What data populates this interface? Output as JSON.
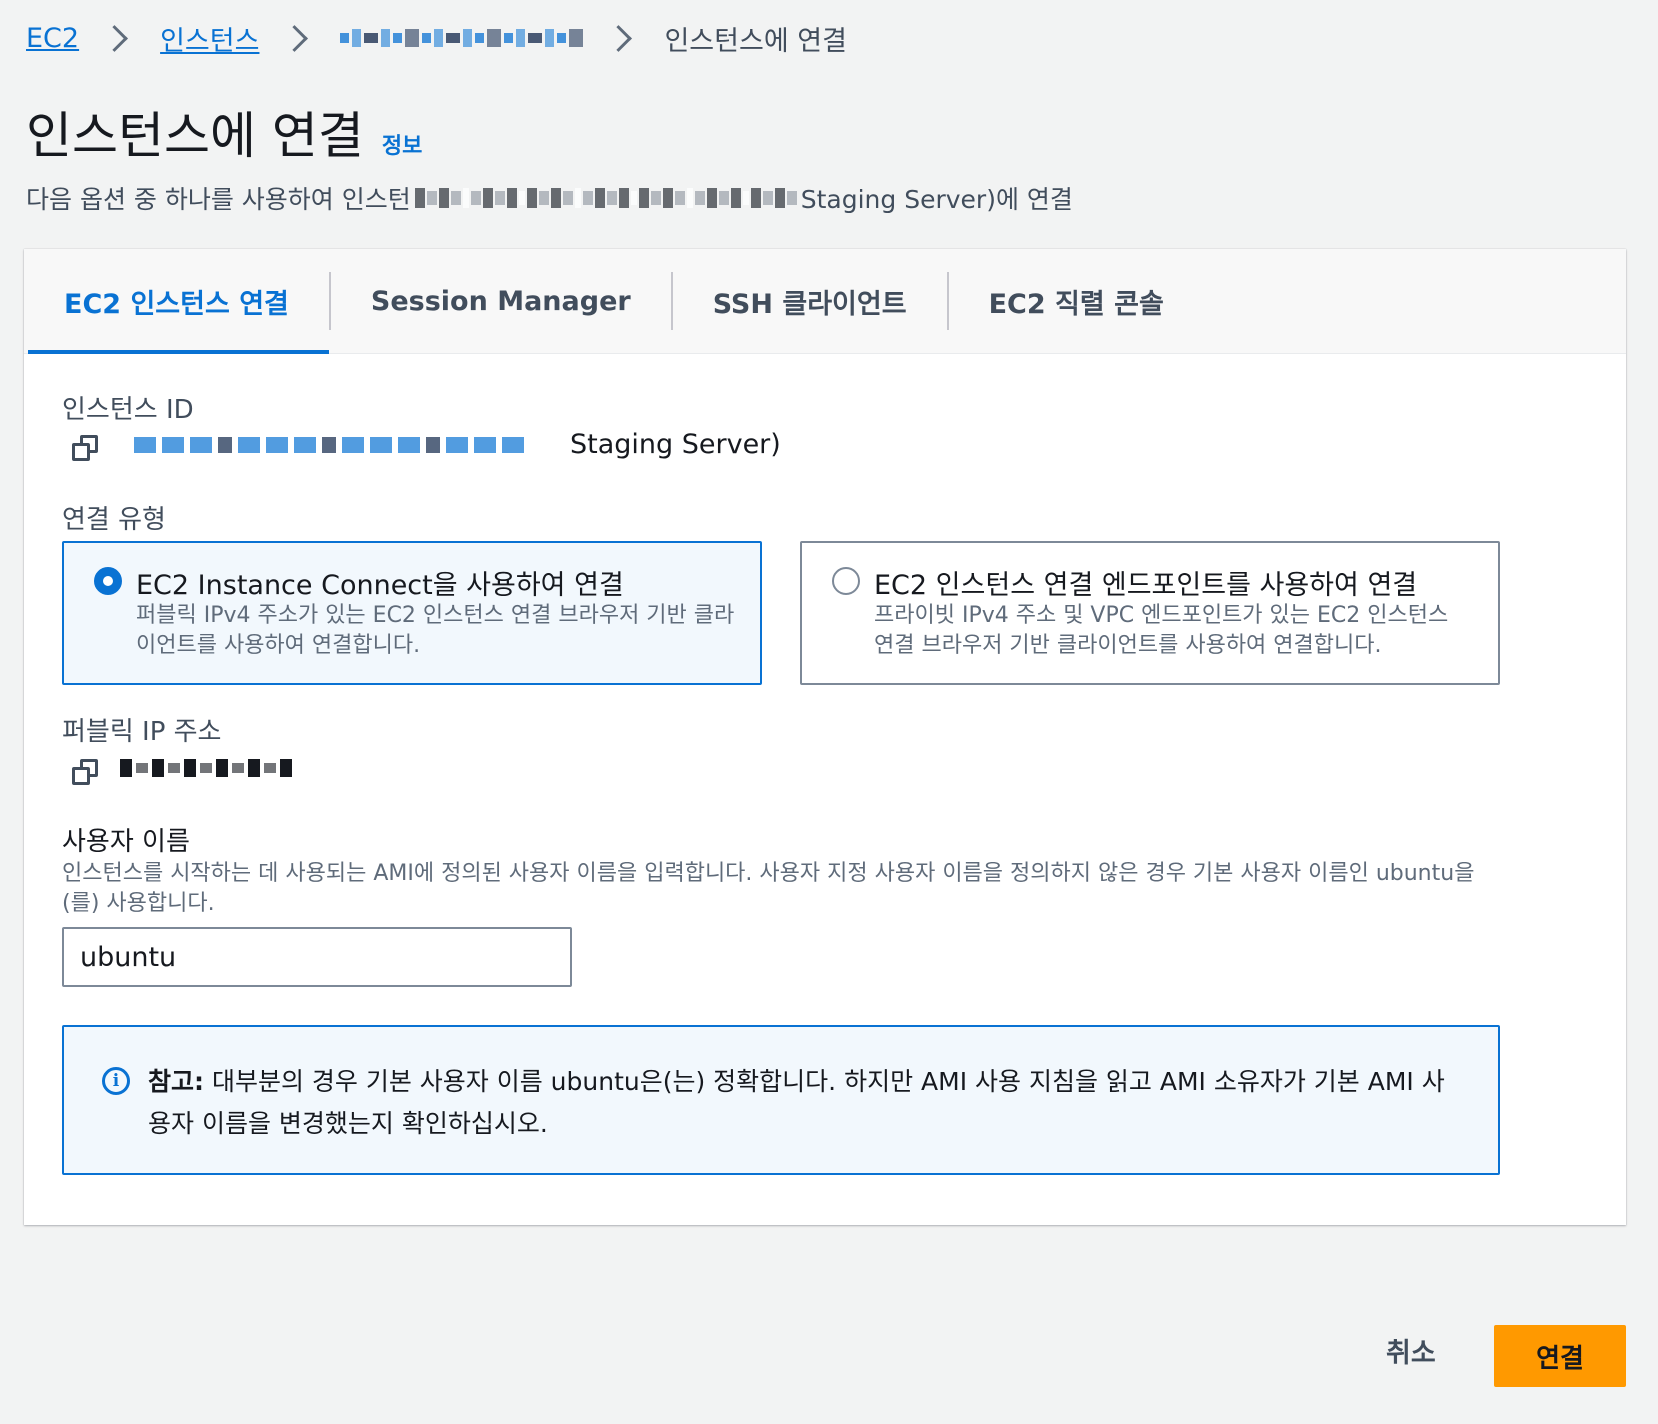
{
  "breadcrumb": {
    "items": [
      "EC2",
      "인스턴스"
    ],
    "current": "인스턴스에 연결"
  },
  "page": {
    "title": "인스턴스에 연결",
    "info_link": "정보",
    "description_prefix": "다음 옵션 중 하나를 사용하여 인스턴",
    "description_suffix": "Staging Server)에 연결"
  },
  "tabs": [
    "EC2 인스턴스 연결",
    "Session Manager",
    "SSH 클라이언트",
    "EC2 직렬 콘솔"
  ],
  "instance": {
    "id_label": "인스턴스 ID",
    "id_visible_suffix": "Staging Server)"
  },
  "connection_type": {
    "label": "연결 유형",
    "options": [
      {
        "title": "EC2 Instance Connect을 사용하여 연결",
        "description": "퍼블릭 IPv4 주소가 있는 EC2 인스턴스 연결 브라우저 기반 클라이언트를 사용하여 연결합니다.",
        "selected": true
      },
      {
        "title": "EC2 인스턴스 연결 엔드포인트를 사용하여 연결",
        "description": "프라이빗 IPv4 주소 및 VPC 엔드포인트가 있는 EC2 인스턴스 연결 브라우저 기반 클라이언트를 사용하여 연결합니다.",
        "selected": false
      }
    ]
  },
  "public_ip": {
    "label": "퍼블릭 IP 주소"
  },
  "username": {
    "label": "사용자 이름",
    "hint": "인스턴스를 시작하는 데 사용되는 AMI에 정의된 사용자 이름을 입력합니다. 사용자 지정 사용자 이름을 정의하지 않은 경우 기본 사용자 이름인 ubuntu을(를) 사용합니다.",
    "value": "ubuntu"
  },
  "note": {
    "prefix": "참고:",
    "text": " 대부분의 경우 기본 사용자 이름 ubuntu은(는) 정확합니다. 하지만 AMI 사용 지침을 읽고 AMI 소유자가 기본 AMI 사용자 이름을 변경했는지 확인하십시오."
  },
  "actions": {
    "cancel": "취소",
    "connect": "연결"
  },
  "colors": {
    "link": "#0972d3",
    "primary_button": "#ff9900",
    "background": "#f2f3f3"
  }
}
